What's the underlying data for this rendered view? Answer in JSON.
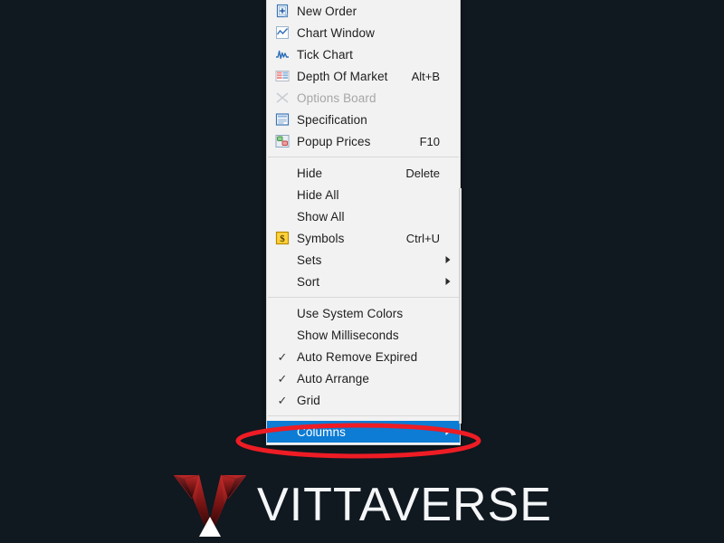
{
  "background_color": "#101820",
  "context_menu": {
    "name": "market-watch-context-menu",
    "background_color": "#f2f2f2",
    "highlight_color": "#0c7cd5",
    "sections": [
      {
        "items": [
          {
            "label": "New Order",
            "icon": "new-order-icon",
            "shortcut": "",
            "checked": false,
            "submenu": false,
            "disabled": false,
            "highlighted": false
          },
          {
            "label": "Chart Window",
            "icon": "chart-window-icon",
            "shortcut": "",
            "checked": false,
            "submenu": false,
            "disabled": false,
            "highlighted": false
          },
          {
            "label": "Tick Chart",
            "icon": "tick-chart-icon",
            "shortcut": "",
            "checked": false,
            "submenu": false,
            "disabled": false,
            "highlighted": false
          },
          {
            "label": "Depth Of Market",
            "icon": "depth-of-market-icon",
            "shortcut": "Alt+B",
            "checked": false,
            "submenu": false,
            "disabled": false,
            "highlighted": false
          },
          {
            "label": "Options Board",
            "icon": "options-board-icon",
            "shortcut": "",
            "checked": false,
            "submenu": false,
            "disabled": true,
            "highlighted": false
          },
          {
            "label": "Specification",
            "icon": "specification-icon",
            "shortcut": "",
            "checked": false,
            "submenu": false,
            "disabled": false,
            "highlighted": false
          },
          {
            "label": "Popup Prices",
            "icon": "popup-prices-icon",
            "shortcut": "F10",
            "checked": false,
            "submenu": false,
            "disabled": false,
            "highlighted": false
          }
        ]
      },
      {
        "items": [
          {
            "label": "Hide",
            "icon": "",
            "shortcut": "Delete",
            "checked": false,
            "submenu": false,
            "disabled": false,
            "highlighted": false
          },
          {
            "label": "Hide All",
            "icon": "",
            "shortcut": "",
            "checked": false,
            "submenu": false,
            "disabled": false,
            "highlighted": false
          },
          {
            "label": "Show All",
            "icon": "",
            "shortcut": "",
            "checked": false,
            "submenu": false,
            "disabled": false,
            "highlighted": false
          },
          {
            "label": "Symbols",
            "icon": "symbols-icon",
            "shortcut": "Ctrl+U",
            "checked": false,
            "submenu": false,
            "disabled": false,
            "highlighted": false
          },
          {
            "label": "Sets",
            "icon": "",
            "shortcut": "",
            "checked": false,
            "submenu": true,
            "disabled": false,
            "highlighted": false
          },
          {
            "label": "Sort",
            "icon": "",
            "shortcut": "",
            "checked": false,
            "submenu": true,
            "disabled": false,
            "highlighted": false
          }
        ]
      },
      {
        "items": [
          {
            "label": "Use System Colors",
            "icon": "",
            "shortcut": "",
            "checked": false,
            "submenu": false,
            "disabled": false,
            "highlighted": false
          },
          {
            "label": "Show Milliseconds",
            "icon": "",
            "shortcut": "",
            "checked": false,
            "submenu": false,
            "disabled": false,
            "highlighted": false
          },
          {
            "label": "Auto Remove Expired",
            "icon": "",
            "shortcut": "",
            "checked": true,
            "submenu": false,
            "disabled": false,
            "highlighted": false
          },
          {
            "label": "Auto Arrange",
            "icon": "",
            "shortcut": "",
            "checked": true,
            "submenu": false,
            "disabled": false,
            "highlighted": false
          },
          {
            "label": "Grid",
            "icon": "",
            "shortcut": "",
            "checked": true,
            "submenu": false,
            "disabled": false,
            "highlighted": false
          }
        ]
      },
      {
        "items": [
          {
            "label": "Columns",
            "icon": "",
            "shortcut": "",
            "checked": false,
            "submenu": true,
            "disabled": false,
            "highlighted": true
          }
        ]
      }
    ]
  },
  "annotation": {
    "shape": "ellipse",
    "color": "#ee1c24",
    "target_label": "Columns"
  },
  "logo": {
    "wordmark": "VITTAVERSE",
    "mark_icon": "vittaverse-v-mark",
    "mark_color_top": "#c62828",
    "mark_color_bottom": "#1a0606",
    "text_color": "#f4f6f8"
  }
}
